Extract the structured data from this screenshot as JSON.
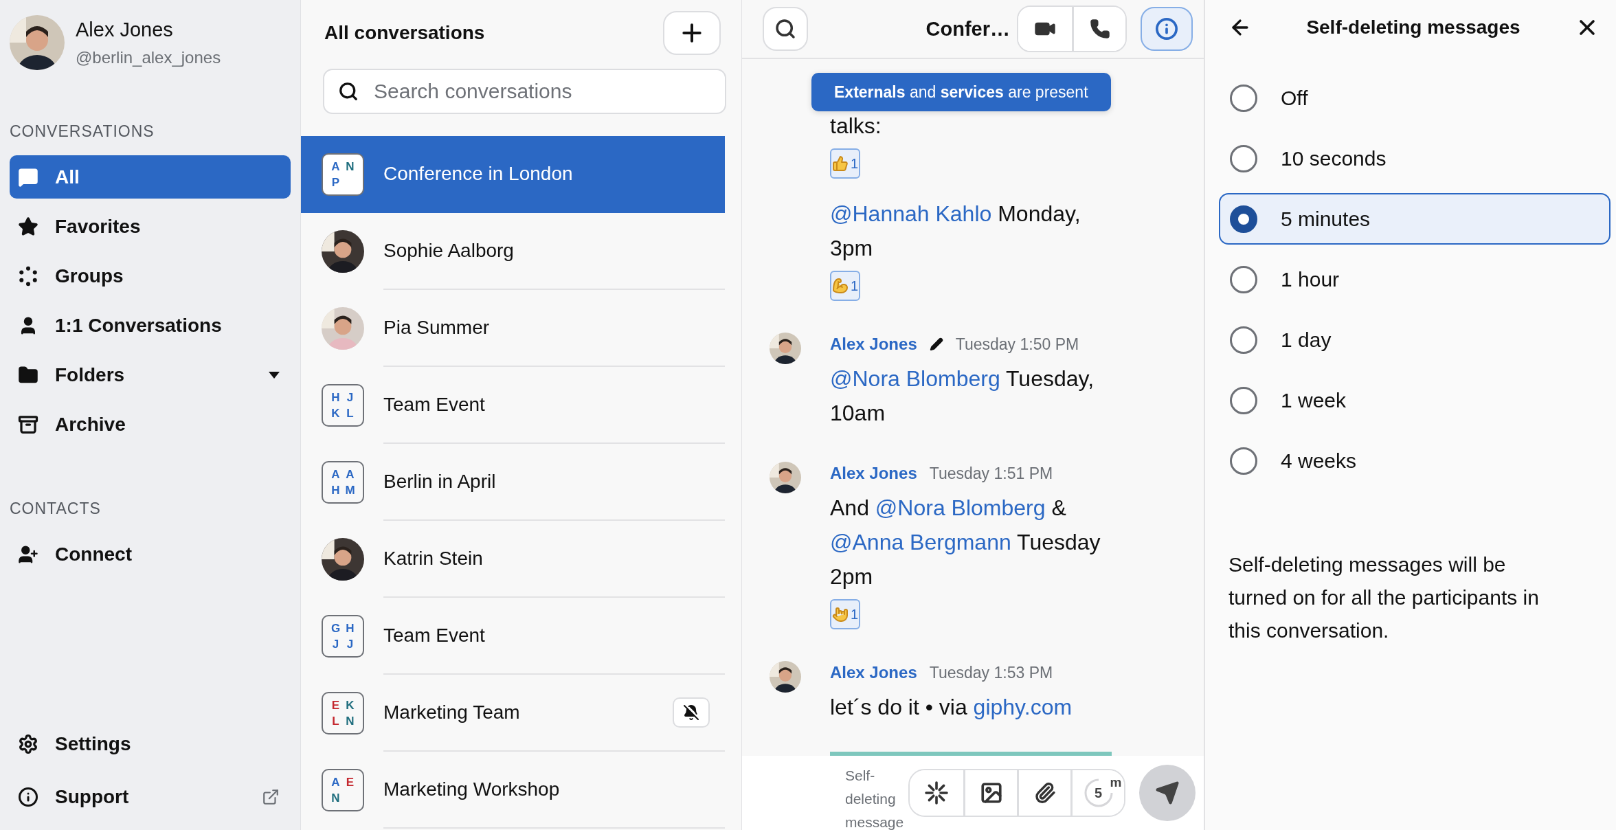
{
  "profile": {
    "name": "Alex Jones",
    "handle": "@berlin_alex_jones"
  },
  "sidebar": {
    "sections": [
      {
        "title": "CONVERSATIONS",
        "items": [
          {
            "label": "All",
            "selected": true,
            "has_menu": false
          },
          {
            "label": "Favorites",
            "selected": false,
            "has_menu": false
          },
          {
            "label": "Groups",
            "selected": false,
            "has_menu": false
          },
          {
            "label": "1:1 Conversations",
            "selected": false,
            "has_menu": false
          },
          {
            "label": "Folders",
            "selected": false,
            "has_menu": true
          },
          {
            "label": "Archive",
            "selected": false,
            "has_menu": false
          }
        ]
      },
      {
        "title": "CONTACTS",
        "items": [
          {
            "label": "Connect",
            "selected": false,
            "has_menu": false
          }
        ]
      }
    ],
    "footer": [
      {
        "label": "Settings",
        "external": false
      },
      {
        "label": "Support",
        "external": true
      }
    ]
  },
  "conversation_list": {
    "title": "All conversations",
    "search": {
      "placeholder": "Search conversations"
    },
    "items": [
      {
        "name": "Conference in London",
        "kind": "group",
        "selected": true,
        "muted": false,
        "initials": [
          {
            "text": "A",
            "color": "#2b68c4"
          },
          {
            "text": "N",
            "color": "#1f6e7e"
          },
          {
            "text": "P",
            "color": "#2b68c4"
          }
        ]
      },
      {
        "name": "Sophie Aalborg",
        "kind": "person",
        "selected": false,
        "muted": false
      },
      {
        "name": "Pia Summer",
        "kind": "person",
        "selected": false,
        "muted": false
      },
      {
        "name": "Team Event",
        "kind": "group",
        "selected": false,
        "muted": false,
        "initials": [
          {
            "text": "H",
            "color": "#2b68c4"
          },
          {
            "text": "J",
            "color": "#2b68c4"
          },
          {
            "text": "K",
            "color": "#2b68c4"
          },
          {
            "text": "L",
            "color": "#2b68c4"
          }
        ]
      },
      {
        "name": "Berlin in April",
        "kind": "group",
        "selected": false,
        "muted": false,
        "initials": [
          {
            "text": "A",
            "color": "#2b68c4"
          },
          {
            "text": "A",
            "color": "#2b68c4"
          },
          {
            "text": "H",
            "color": "#2b68c4"
          },
          {
            "text": "M",
            "color": "#2b68c4"
          }
        ]
      },
      {
        "name": "Katrin Stein",
        "kind": "person",
        "selected": false,
        "muted": false
      },
      {
        "name": "Team Event",
        "kind": "group",
        "selected": false,
        "muted": false,
        "initials": [
          {
            "text": "G",
            "color": "#2b68c4"
          },
          {
            "text": "H",
            "color": "#2b68c4"
          },
          {
            "text": "J",
            "color": "#2b68c4"
          },
          {
            "text": "J",
            "color": "#2b68c4"
          }
        ]
      },
      {
        "name": "Marketing Team",
        "kind": "group",
        "selected": false,
        "muted": true,
        "initials": [
          {
            "text": "E",
            "color": "#c4272e"
          },
          {
            "text": "K",
            "color": "#1f6e7e"
          },
          {
            "text": "L",
            "color": "#c4272e"
          },
          {
            "text": "N",
            "color": "#1f6e7e"
          }
        ]
      },
      {
        "name": "Marketing Workshop",
        "kind": "group",
        "selected": false,
        "muted": false,
        "initials": [
          {
            "text": "A",
            "color": "#2b68c4"
          },
          {
            "text": "E",
            "color": "#c4272e"
          },
          {
            "text": "N",
            "color": "#1f6e7e"
          }
        ]
      }
    ]
  },
  "chat": {
    "title": "Confer…",
    "info_selected": true,
    "banner": "**Externals** and **services** are present",
    "messages": [
      {
        "kind": "continuation",
        "parts": [
          {
            "kind": "text",
            "text": "talks:"
          }
        ],
        "reactions": [
          {
            "kind": "thumbs",
            "count": "1"
          }
        ]
      },
      {
        "kind": "continuation",
        "parts": [
          {
            "kind": "mention",
            "text": "@Hannah Kahlo"
          },
          {
            "kind": "text",
            "text": " Monday, 3pm"
          }
        ],
        "reactions": [
          {
            "kind": "muscle",
            "count": "1"
          }
        ]
      },
      {
        "kind": "full",
        "author": "Alex Jones",
        "edited": true,
        "time": "Tuesday 1:50 PM",
        "parts": [
          {
            "kind": "mention",
            "text": "@Nora Blomberg"
          },
          {
            "kind": "text",
            "text": " Tuesday, 10am"
          }
        ]
      },
      {
        "kind": "full",
        "author": "Alex Jones",
        "edited": false,
        "time": "Tuesday 1:51 PM",
        "parts": [
          {
            "kind": "text",
            "text": "And "
          },
          {
            "kind": "mention",
            "text": "@Nora Blomberg"
          },
          {
            "kind": "text",
            "text": " & "
          },
          {
            "kind": "mention",
            "text": "@Anna Bergmann"
          },
          {
            "kind": "text",
            "text": " Tuesday 2pm"
          }
        ],
        "reactions": [
          {
            "kind": "horns",
            "count": "1"
          }
        ]
      },
      {
        "kind": "full",
        "author": "Alex Jones",
        "edited": false,
        "time": "Tuesday 1:53 PM",
        "parts": [
          {
            "kind": "text",
            "text": "let´s do it • via "
          },
          {
            "kind": "link",
            "text": "giphy.com"
          }
        ],
        "attachment": {
          "kind": "picture"
        }
      }
    ],
    "composer": {
      "self_deleting_label": "Self-deleting message",
      "timer": {
        "value": "5",
        "unit": "m"
      },
      "send_disabled": true
    }
  },
  "settings_panel": {
    "title": "Self-deleting messages",
    "options": [
      {
        "label": "Off",
        "selected": false
      },
      {
        "label": "10 seconds",
        "selected": false
      },
      {
        "label": "5 minutes",
        "selected": true
      },
      {
        "label": "1 hour",
        "selected": false
      },
      {
        "label": "1 day",
        "selected": false
      },
      {
        "label": "1 week",
        "selected": false
      },
      {
        "label": "4 weeks",
        "selected": false
      }
    ],
    "description": "Self-deleting messages will be turned on for all the participants in this conversation."
  }
}
